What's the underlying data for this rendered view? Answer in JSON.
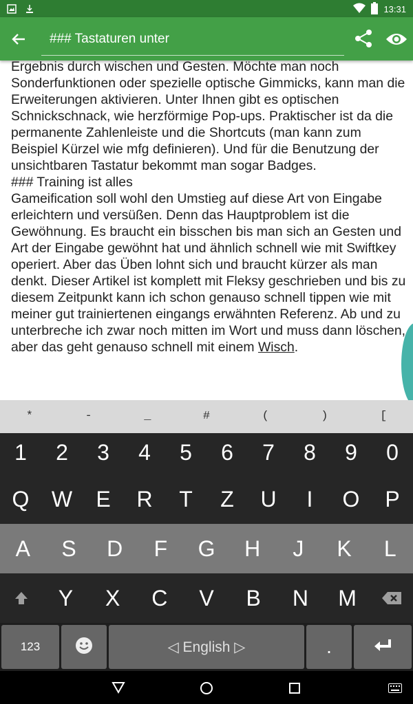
{
  "status": {
    "time": "13:31"
  },
  "appbar": {
    "title": "### Tastaturen unter"
  },
  "content": {
    "paragraph1": "Ergebnis durch wischen und Gesten. Möchte man noch Sonderfunktionen oder spezielle optische Gimmicks, kann man die Erweiterungen aktivieren. Unter Ihnen gibt es optischen Schnickschnack, wie herzförmige Pop-ups. Praktischer ist da die permanente Zahlenleiste und die Shortcuts (man kann zum Beispiel Kürzel wie mfg definieren). Und für die Benutzung der unsichtbaren Tastatur bekommt man sogar Badges.",
    "heading": "### Training ist alles",
    "paragraph2": "Gameification soll wohl den Umstieg auf diese Art von Eingabe erleichtern und versüßen. Denn das Hauptproblem ist die Gewöhnung. Es braucht ein bisschen bis man sich an Gesten und Art der Eingabe gewöhnt hat und ähnlich schnell wie mit Swiftkey operiert. Aber das Üben lohnt sich und braucht kürzer als man denkt. Dieser Artikel ist komplett mit Fleksy geschrieben und bis zu diesem Zeitpunkt kann ich schon genauso schnell tippen wie mit meiner gut trainiertenen eingangs erwähnten Referenz. Ab und zu unterbreche ich zwar noch mitten im Wort und muss dann löschen, aber das geht genauso schnell mit einem",
    "underlined_word": "Wisch",
    "trailing": "."
  },
  "keyboard": {
    "symbols": [
      "*",
      "-",
      "_",
      "#",
      "(",
      ")",
      "["
    ],
    "numbers": [
      "1",
      "2",
      "3",
      "4",
      "5",
      "6",
      "7",
      "8",
      "9",
      "0"
    ],
    "row1": [
      "Q",
      "W",
      "E",
      "R",
      "T",
      "Z",
      "U",
      "I",
      "O",
      "P"
    ],
    "row2": [
      "A",
      "S",
      "D",
      "F",
      "G",
      "H",
      "J",
      "K",
      "L"
    ],
    "row3": [
      "Y",
      "X",
      "C",
      "V",
      "B",
      "N",
      "M"
    ],
    "mode_key": "123",
    "space_label": "◁ English ▷",
    "period_key": "."
  },
  "icons": {
    "back": "arrow-left-icon",
    "share": "share-icon",
    "preview": "eye-icon",
    "shift": "shift-icon",
    "backspace": "backspace-icon",
    "emoji": "smiley-icon",
    "enter": "enter-icon"
  },
  "colors": {
    "accent": "#43a047",
    "statusbar": "#2e7d32",
    "teal": "#26a69a"
  }
}
